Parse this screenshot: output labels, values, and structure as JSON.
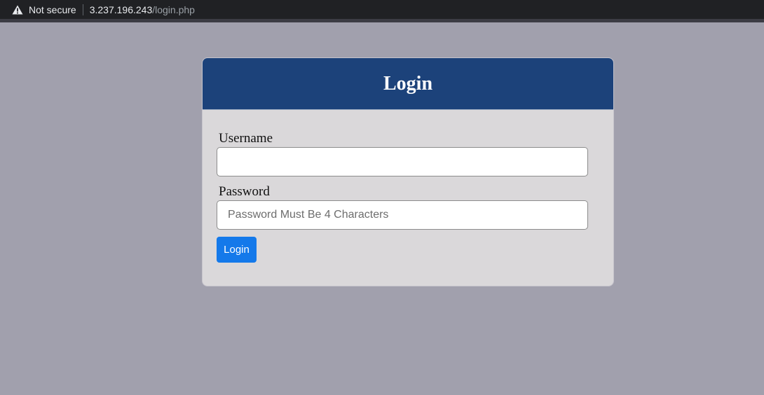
{
  "browser": {
    "security_label": "Not secure",
    "url_host": "3.237.196.243",
    "url_path": "/login.php",
    "warning_icon": "warning-triangle-icon"
  },
  "login_card": {
    "title": "Login",
    "header_color": "#1c427a",
    "username": {
      "label": "Username",
      "value": "",
      "placeholder": ""
    },
    "password": {
      "label": "Password",
      "value": "",
      "placeholder": "Password Must Be 4 Characters"
    },
    "submit_label": "Login",
    "button_color": "#1479ea"
  }
}
